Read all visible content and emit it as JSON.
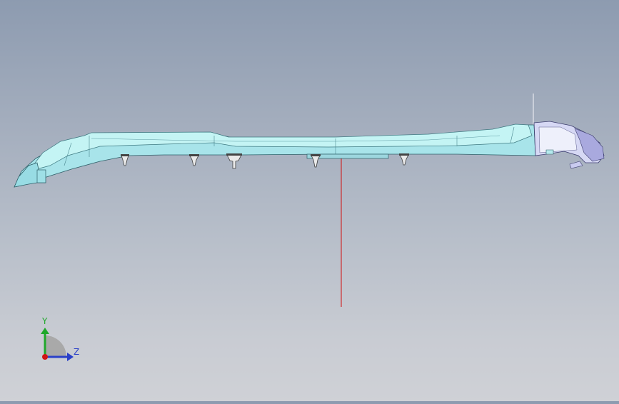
{
  "viewport": {
    "background_top": "#8d9bb0",
    "background_bottom": "#cfd1d6",
    "model_color": "#b8f0f0",
    "model_edge_color": "#2e5f68",
    "cap_color": "#c8c8ee",
    "section_line_color": "#d01010"
  },
  "triad": {
    "y_label": "Y",
    "z_label": "Z",
    "y_color": "#1fa82a",
    "z_color": "#2a40c8",
    "x_color": "#d01515"
  }
}
